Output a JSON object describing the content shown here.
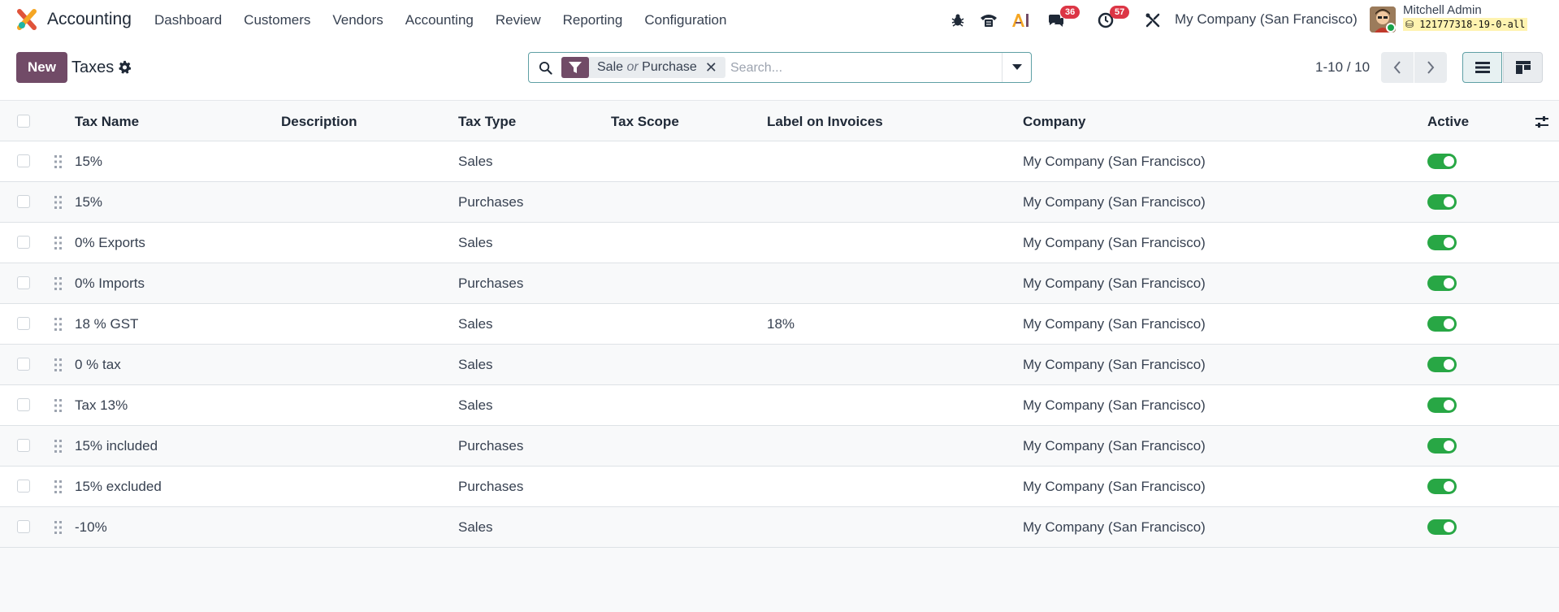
{
  "navbar": {
    "app_name": "Accounting",
    "menu": [
      "Dashboard",
      "Customers",
      "Vendors",
      "Accounting",
      "Review",
      "Reporting",
      "Configuration"
    ],
    "messages_badge": "36",
    "activities_badge": "57",
    "company": "My Company (San Francisco)",
    "user_name": "Mitchell Admin",
    "db_name": "121777318-19-0-all"
  },
  "control_panel": {
    "new_label": "New",
    "title": "Taxes",
    "search": {
      "facet_part1": "Sale",
      "facet_or": "or",
      "facet_part2": "Purchase",
      "placeholder": "Search..."
    },
    "pager": "1-10 / 10"
  },
  "table": {
    "headers": {
      "name": "Tax Name",
      "description": "Description",
      "type": "Tax Type",
      "scope": "Tax Scope",
      "label": "Label on Invoices",
      "company": "Company",
      "active": "Active"
    },
    "rows": [
      {
        "name": "15%",
        "description": "",
        "type": "Sales",
        "scope": "",
        "label": "",
        "company": "My Company (San Francisco)",
        "active": true
      },
      {
        "name": "15%",
        "description": "",
        "type": "Purchases",
        "scope": "",
        "label": "",
        "company": "My Company (San Francisco)",
        "active": true
      },
      {
        "name": "0% Exports",
        "description": "",
        "type": "Sales",
        "scope": "",
        "label": "",
        "company": "My Company (San Francisco)",
        "active": true
      },
      {
        "name": "0% Imports",
        "description": "",
        "type": "Purchases",
        "scope": "",
        "label": "",
        "company": "My Company (San Francisco)",
        "active": true
      },
      {
        "name": "18 % GST",
        "description": "",
        "type": "Sales",
        "scope": "",
        "label": "18%",
        "company": "My Company (San Francisco)",
        "active": true
      },
      {
        "name": "0 % tax",
        "description": "",
        "type": "Sales",
        "scope": "",
        "label": "",
        "company": "My Company (San Francisco)",
        "active": true
      },
      {
        "name": "Tax 13%",
        "description": "",
        "type": "Sales",
        "scope": "",
        "label": "",
        "company": "My Company (San Francisco)",
        "active": true
      },
      {
        "name": "15% included",
        "description": "",
        "type": "Purchases",
        "scope": "",
        "label": "",
        "company": "My Company (San Francisco)",
        "active": true
      },
      {
        "name": "15% excluded",
        "description": "",
        "type": "Purchases",
        "scope": "",
        "label": "",
        "company": "My Company (San Francisco)",
        "active": true
      },
      {
        "name": "-10%",
        "description": "",
        "type": "Sales",
        "scope": "",
        "label": "",
        "company": "My Company (San Francisco)",
        "active": true
      }
    ]
  },
  "colors": {
    "brand": "#714B67",
    "active_toggle": "#28a745",
    "badge": "#dc3545"
  }
}
